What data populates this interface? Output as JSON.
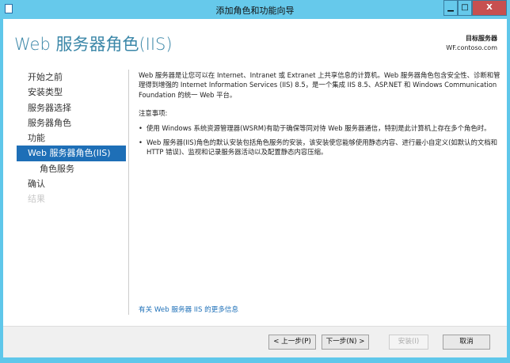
{
  "window": {
    "title": "添加角色和功能向导",
    "minimize": "▁",
    "maximize": "□",
    "close": "X"
  },
  "header": {
    "title": "Web 服务器角色(IIS)",
    "target_label": "目标服务器",
    "target_server": "WF.contoso.com"
  },
  "sidebar": {
    "items": [
      {
        "label": "开始之前",
        "state": "normal"
      },
      {
        "label": "安装类型",
        "state": "normal"
      },
      {
        "label": "服务器选择",
        "state": "normal"
      },
      {
        "label": "服务器角色",
        "state": "normal"
      },
      {
        "label": "功能",
        "state": "normal"
      },
      {
        "label": "Web 服务器角色(IIS)",
        "state": "selected"
      },
      {
        "label": "角色服务",
        "state": "sub"
      },
      {
        "label": "确认",
        "state": "normal"
      },
      {
        "label": "结果",
        "state": "disabled"
      }
    ]
  },
  "content": {
    "intro": "Web 服务器是让您可以在 Internet、Intranet 或 Extranet 上共享信息的计算机。Web 服务器角色包含安全性、诊断和管理得到增强的 Internet Information Services (IIS) 8.5，是一个集成 IIS 8.5、ASP.NET 和 Windows Communication Foundation 的统一 Web 平台。",
    "notes_title": "注意事项:",
    "bullets": [
      "使用 Windows 系统资源管理器(WSRM)有助于确保等同对待 Web 服务器通信，特别是此计算机上存在多个角色时。",
      "Web 服务器(IIS)角色的默认安装包括角色服务的安装，该安装使您能够使用静态内容、进行最小自定义(如默认的文档和 HTTP 错误)、监视和记录服务器活动以及配置静态内容压缩。"
    ],
    "more_info_link": "有关 Web 服务器 IIS 的更多信息"
  },
  "footer": {
    "prev": "< 上一步(P)",
    "next": "下一步(N) >",
    "install": "安装(I)",
    "cancel": "取消"
  },
  "colors": {
    "accent": "#1e6fb7",
    "titlebar": "#66c9eb",
    "heading": "#3b87a8"
  }
}
